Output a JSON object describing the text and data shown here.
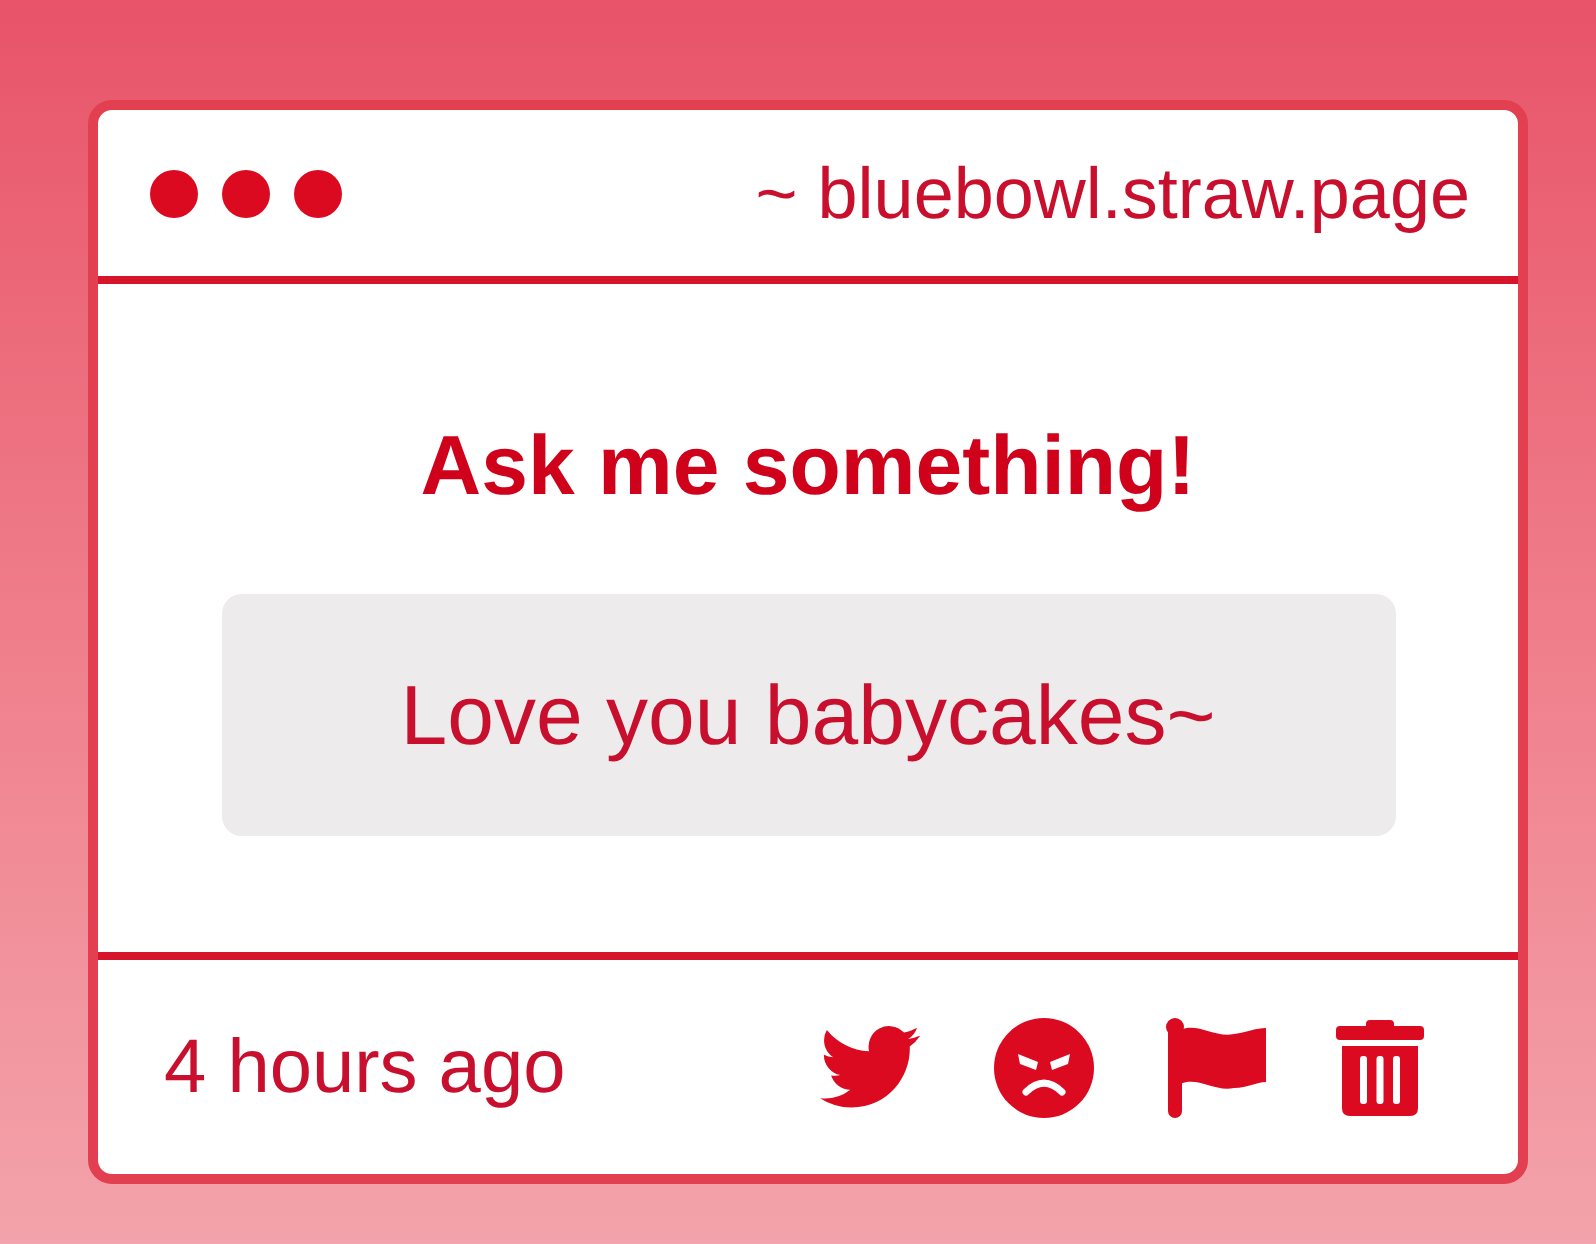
{
  "window": {
    "address": "~ bluebowl.straw.page"
  },
  "prompt": {
    "title": "Ask me something!",
    "question": "Love you babycakes~"
  },
  "footer": {
    "time": "4 hours ago"
  }
}
